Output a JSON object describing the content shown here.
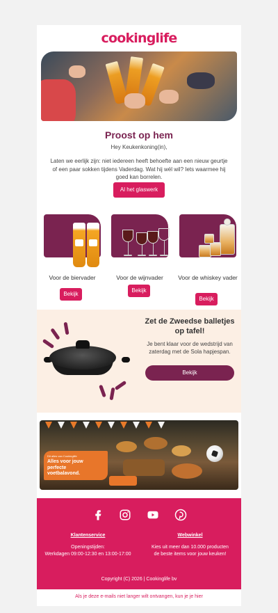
{
  "brand": {
    "logo": "cookinglife",
    "accent": "#d81d5e",
    "plum": "#7a2350"
  },
  "hero": {
    "title": "Proost op hem",
    "greeting": "Hey Keukenkoning(in),",
    "intro": "Laten we eerlijk zijn: niet iedereen heeft behoefte aan een nieuw geurtje of een paar sokken tijdens Vaderdag. Wat hij wél wil? Iets waarmee hij goed kan borrelen.",
    "cta": "Al het glaswerk"
  },
  "products": [
    {
      "label": "Voor de biervader",
      "cta": "Bekijk"
    },
    {
      "label": "Voor de wijnvader",
      "cta": "Bekijk"
    },
    {
      "label": "Voor de whiskey vader",
      "cta": "Bekijk"
    }
  ],
  "sola": {
    "title": "Zet de Zweedse balletjes op tafel!",
    "text": "Je bent klaar voor de wedstrijd van zaterdag met de Sola hapjespan.",
    "cta": "Bekijk"
  },
  "banner": {
    "small": "Dit alles van Cookinglife",
    "headline": "Alles voor jouw perfecte voetbalavond."
  },
  "footer": {
    "social": [
      "facebook-icon",
      "instagram-icon",
      "youtube-icon",
      "pinterest-icon"
    ],
    "service": {
      "title": "Klantenservice",
      "text1": "Openingstijden:",
      "text2": "Werkdagen 09:00-12:30 en 13:00-17:00"
    },
    "webshop": {
      "title": "Webwinkel",
      "text1": "Kies uit meer dan 10.000 producten",
      "text2": "de beste items voor jouw keuken!"
    },
    "copyright": "Copyright (C) 2026 | Cookinglife bv"
  },
  "unsubscribe": "Als je deze e-mails niet langer wilt ontvangen, kun je je hier"
}
